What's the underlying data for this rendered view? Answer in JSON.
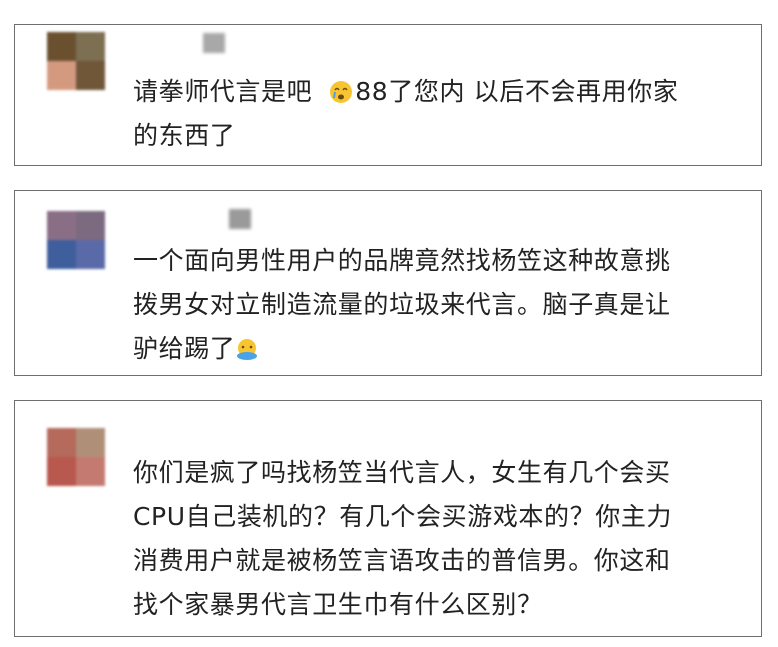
{
  "comments": [
    {
      "lines": [
        "请拳师代言是吧",
        "88了您内  以后不会再用你家",
        "的东西了"
      ],
      "emoji": "crying-face"
    },
    {
      "lines": [
        "一个面向男性用户的品牌竟然找杨笠这种故意挑",
        "拨男女对立制造流量的垃圾来代言。脑子真是让",
        "驴给踢了"
      ],
      "emoji": "covering-face"
    },
    {
      "lines": [
        "你们是疯了吗找杨笠当代言人，女生有几个会买",
        "CPU自己装机的？有几个会买游戏本的？你主力",
        "消费用户就是被杨笠言语攻击的普信男。你这和",
        "找个家暴男代言卫生巾有什么区别？"
      ]
    }
  ],
  "colors": {
    "card_border": "#6e6e6e",
    "text": "#222222",
    "emoji_yellow": "#f7c531"
  }
}
